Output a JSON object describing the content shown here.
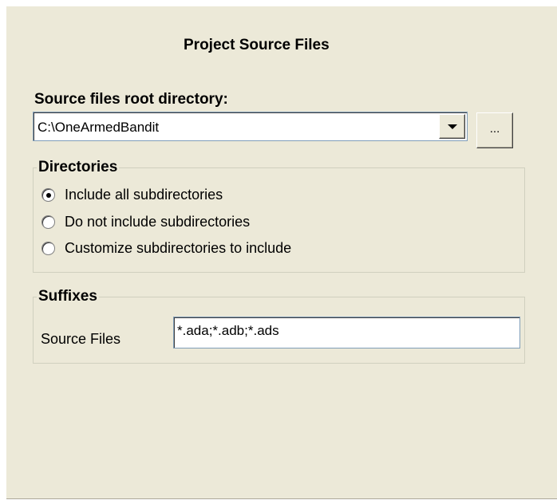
{
  "title": "Project Source Files",
  "root": {
    "label": "Source files root directory:",
    "value": "C:\\OneArmedBandit",
    "browse_label": "..."
  },
  "directories": {
    "legend": "Directories",
    "options": [
      {
        "label": "Include all subdirectories",
        "checked": true
      },
      {
        "label": "Do not include subdirectories",
        "checked": false
      },
      {
        "label": "Customize subdirectories to include",
        "checked": false
      }
    ]
  },
  "suffixes": {
    "legend": "Suffixes",
    "label": "Source Files",
    "value": "*.ada;*.adb;*.ads"
  },
  "icons": {
    "combo_arrow": "chevron-down-icon"
  },
  "colors": {
    "panel_bg": "#ECE9D8",
    "input_border": "#7F9DB9",
    "group_border": "#D0D0BF"
  }
}
